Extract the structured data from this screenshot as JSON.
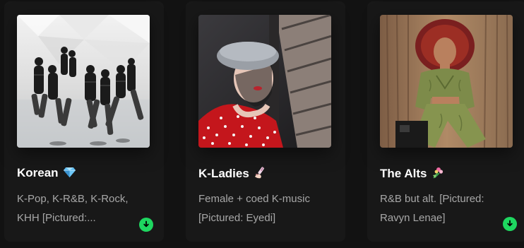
{
  "cards": [
    {
      "title": "Korean",
      "emoji_icon": "gem-icon",
      "description": "K-Pop, K-R&B, K-Rock, KHH [Pictured:...",
      "downloaded": true
    },
    {
      "title": "K-Ladies",
      "emoji_icon": "nail-polish-icon",
      "description": "Female + coed K-music [Pictured: Eyedi]",
      "downloaded": false
    },
    {
      "title": "The Alts",
      "emoji_icon": "bouquet-icon",
      "description": "R&B but alt. [Pictured: Ravyn Lenae]",
      "downloaded": true
    }
  ],
  "colors": {
    "background": "#121212",
    "card": "#181818",
    "title": "#ffffff",
    "subtitle": "#a7a7a7",
    "download_accent": "#1ed760"
  }
}
